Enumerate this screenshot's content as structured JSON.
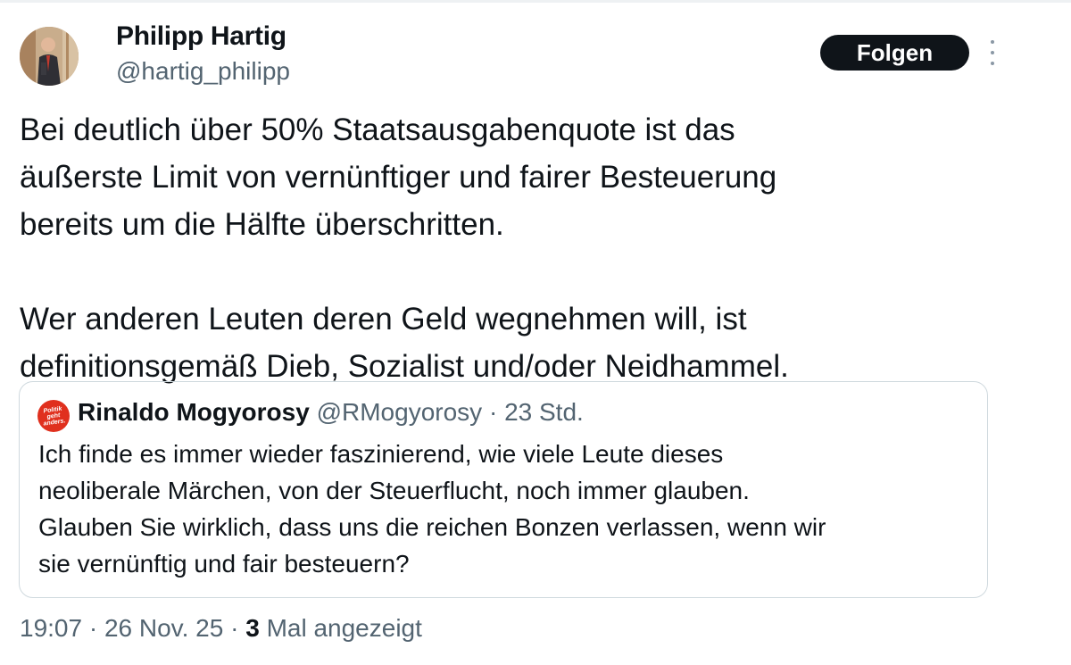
{
  "author": {
    "name": "Philipp Hartig",
    "handle": "@hartig_philipp",
    "avatar_icon": "profile-photo-icon"
  },
  "actions": {
    "follow_label": "Folgen",
    "more_icon": "more-options-icon"
  },
  "tweet": {
    "lines": [
      "Bei deutlich über 50% Staatsausgabenquote ist das",
      "äußerste Limit von vernünftiger und fairer Besteuerung",
      "bereits um die  Hälfte überschritten.",
      "Wer anderen Leuten deren Geld wegnehmen will, ist",
      "definitionsgemäß Dieb, Sozialist und/oder Neidhammel."
    ]
  },
  "quote": {
    "avatar_text": "Politik geht anders.",
    "name": "Rinaldo Mogyorosy",
    "handle": "@RMogyorosy",
    "separator": "·",
    "time": "23 Std.",
    "lines": [
      "Ich finde es immer wieder faszinierend, wie viele Leute dieses",
      "neoliberale Märchen, von der Steuerflucht, noch immer glauben.",
      "Glauben Sie wirklich, dass uns die reichen Bonzen verlassen, wenn wir",
      "sie vernünftig und fair besteuern?"
    ]
  },
  "meta": {
    "time": "19:07",
    "separator": "·",
    "date": "26 Nov. 25",
    "views_count": "3",
    "views_label": "Mal angezeigt"
  },
  "colors": {
    "text": "#0f1419",
    "secondary": "#536471",
    "button": "#0f1419",
    "border": "#cfd9de",
    "quote_avatar": "#e0301e"
  }
}
